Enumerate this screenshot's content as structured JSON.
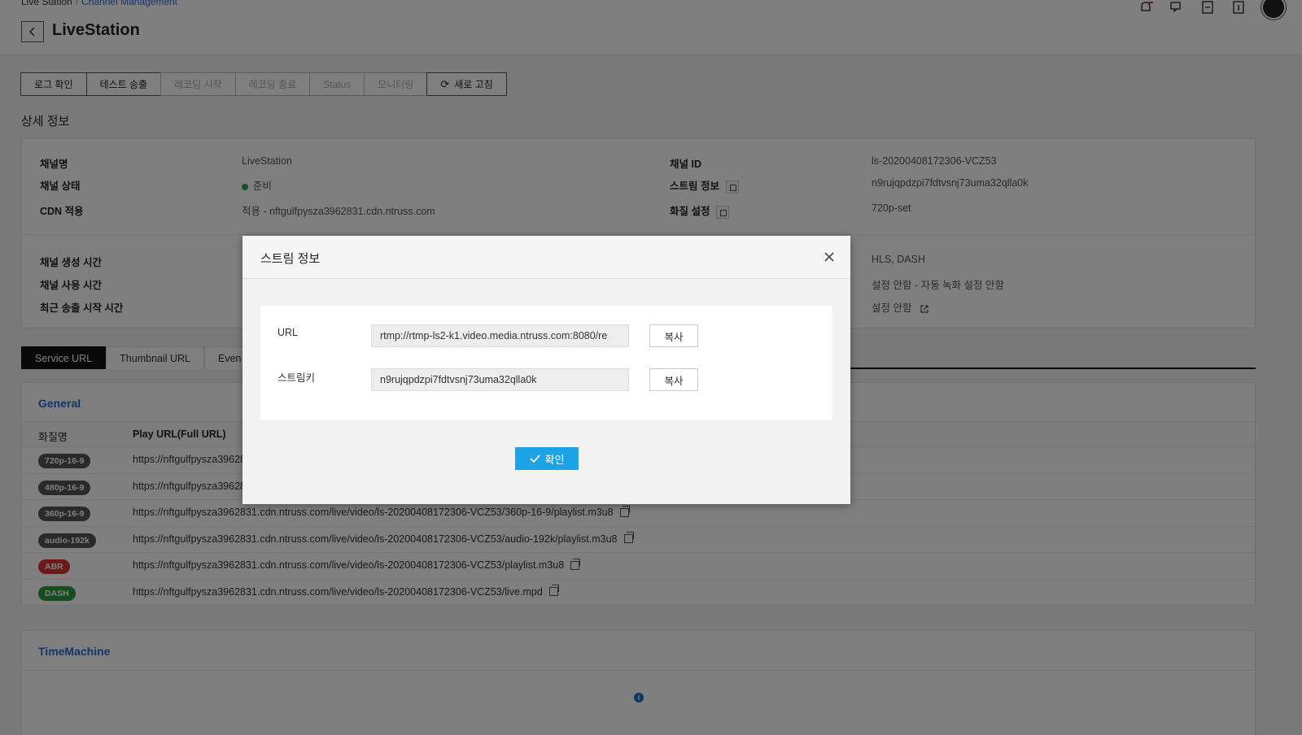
{
  "header": {
    "breadcrumb_root": "Live Station",
    "breadcrumb_current": "Channel Management",
    "title": "LiveStation",
    "icons": [
      "bell-icon",
      "chat-icon",
      "document-icon",
      "info-icon",
      "user-avatar"
    ]
  },
  "toolbar": {
    "log": "로그 확인",
    "test": "테스트 송출",
    "rec_start": "레코딩 시작",
    "rec_stop": "레코딩 종료",
    "status": "Status",
    "monitor": "모니터링",
    "refresh": "새로 고침"
  },
  "detail": {
    "section_title": "상세 정보",
    "channel_name_label": "채널명",
    "channel_name": "LiveStation",
    "channel_status_label": "채널 상태",
    "channel_status": "준비",
    "status_color": "#27a844",
    "cdn_label": "CDN 적용",
    "cdn_value": "적용 - nftgulfpysza3962831.cdn.ntruss.com",
    "channel_id_label": "채널 ID",
    "channel_id": "ls-20200408172306-VCZ53",
    "stream_info_label": "스트림 정보",
    "stream_info": "n9rujqpdzpi7fdtvsnj73uma32qlla0k",
    "quality_label": "화질 설정",
    "quality": "720p-set",
    "created_label": "채널 생성 시간",
    "used_label": "채널 사용 시간",
    "recent_label": "최근 송출 시작 시간",
    "protocol": "HLS, DASH",
    "record_setting": "설정 안함 - 자동 녹화 설정 안함",
    "other_setting": "설정 안함"
  },
  "tabs": [
    "Service URL",
    "Thumbnail URL",
    "Even"
  ],
  "general": {
    "heading": "General",
    "col_quality": "화질명",
    "col_url": "Play URL(Full URL)",
    "rows": [
      {
        "badge": "720p-16-9",
        "url": "https://nftgulfpysza3962831.cdn.ntruss.com/live/video/ls-20200408172306-VCZ53/720p-16-9/playlist.m3u8"
      },
      {
        "badge": "480p-16-9",
        "url": "https://nftgulfpysza3962831.cdn.ntruss.com/live/video/ls-20200408172306-VCZ53/480p-16-9/playlist.m3u8"
      },
      {
        "badge": "360p-16-9",
        "url": "https://nftgulfpysza3962831.cdn.ntruss.com/live/video/ls-20200408172306-VCZ53/360p-16-9/playlist.m3u8"
      },
      {
        "badge": "audio-192k",
        "url": "https://nftgulfpysza3962831.cdn.ntruss.com/live/video/ls-20200408172306-VCZ53/audio-192k/playlist.m3u8"
      },
      {
        "badge": "ABR",
        "url": "https://nftgulfpysza3962831.cdn.ntruss.com/live/video/ls-20200408172306-VCZ53/playlist.m3u8"
      },
      {
        "badge": "DASH",
        "url": "https://nftgulfpysza3962831.cdn.ntruss.com/live/video/ls-20200408172306-VCZ53/live.mpd"
      }
    ]
  },
  "timemachine": {
    "heading": "TimeMachine"
  },
  "modal": {
    "title": "스트림 정보",
    "url_label": "URL",
    "url_value": "rtmp://rtmp-ls2-k1.video.media.ntruss.com:8080/re",
    "key_label": "스트림키",
    "key_value": "n9rujqpdzpi7fdtvsnj73uma32qlla0k",
    "copy_label": "복사",
    "confirm_label": "확인",
    "confirm_color": "#1ba3e6"
  }
}
